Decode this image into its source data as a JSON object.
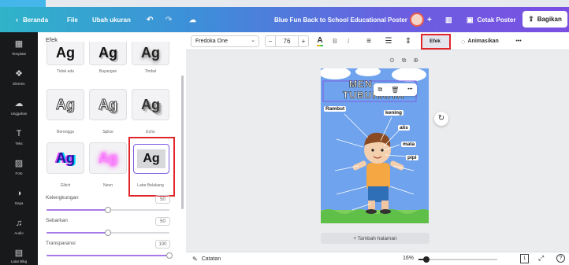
{
  "header": {
    "back_label": "Beranda",
    "file_label": "File",
    "resize_label": "Ubah ukuran",
    "doc_title": "Blue Fun Back to School Educational Poster",
    "print_label": "Cetak Poster",
    "share_label": "Bagikan",
    "plus_label": "+"
  },
  "rail": {
    "items": [
      {
        "label": "Template",
        "icon": "template-icon"
      },
      {
        "label": "Elemen",
        "icon": "elements-icon"
      },
      {
        "label": "Unggahan",
        "icon": "upload-icon"
      },
      {
        "label": "Teks",
        "icon": "text-icon"
      },
      {
        "label": "Foto",
        "icon": "photo-icon"
      },
      {
        "label": "Gaya",
        "icon": "styles-icon"
      },
      {
        "label": "Audio",
        "icon": "audio-icon"
      },
      {
        "label": "Latar Blkg",
        "icon": "background-icon"
      }
    ]
  },
  "panel": {
    "title": "Efek",
    "effects": [
      {
        "sample": "Ag",
        "label": "Tidak ada"
      },
      {
        "sample": "Ag",
        "label": "Bayangan"
      },
      {
        "sample": "Ag",
        "label": "Timbul"
      },
      {
        "sample": "Ag",
        "label": "Berongga"
      },
      {
        "sample": "Ag",
        "label": "Splice"
      },
      {
        "sample": "Ag",
        "label": "Echo"
      },
      {
        "sample": "Ag",
        "label": "Glitch"
      },
      {
        "sample": "Ag",
        "label": "Neon"
      },
      {
        "sample": "Ag",
        "label": "Latar Belakang"
      }
    ],
    "sliders": [
      {
        "label": "Kelengkungan",
        "value": "50",
        "fraction": 0.5
      },
      {
        "label": "Sebarkan",
        "value": "50",
        "fraction": 0.5
      },
      {
        "label": "Transparansi",
        "value": "100",
        "fraction": 1.0
      }
    ]
  },
  "toolbar": {
    "font": "Fredoka One",
    "minus": "−",
    "size": "76",
    "plus": "+",
    "color_letter": "A",
    "bold": "B",
    "italic": "I",
    "effects": "Efek",
    "animate": "Animasikan",
    "more": "•••"
  },
  "poster": {
    "title_line1": "MEN",
    "title_line2": "TUBUHKITA",
    "labels": [
      "Rambut",
      "kening",
      "alis",
      "mata",
      "pipi"
    ]
  },
  "float_toolbar": {
    "more": "•••"
  },
  "canvas": {
    "add_page": "+ Tambah halaman"
  },
  "bottom": {
    "notes": "Catatan",
    "zoom": "16%",
    "zoom_fraction": 0.1
  },
  "colors": {
    "accent": "#7b4fe3",
    "highlight": "#e0262b",
    "slider": "#a57ae8"
  }
}
